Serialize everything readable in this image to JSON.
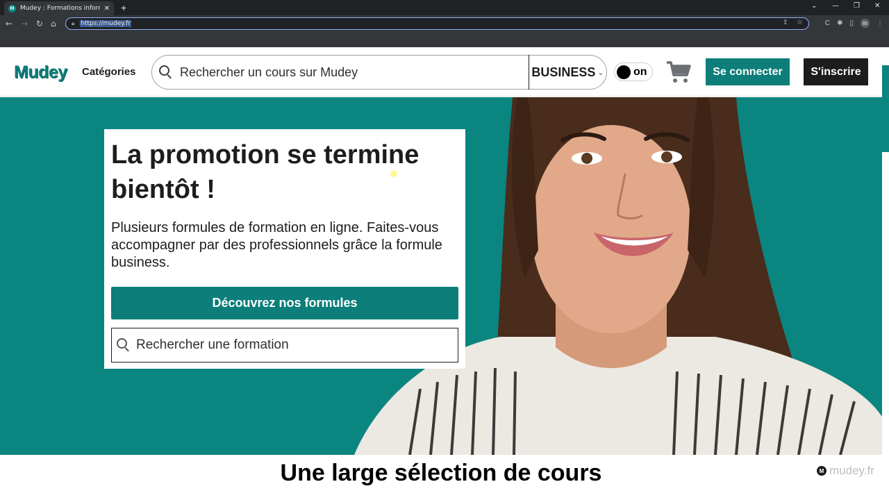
{
  "browser": {
    "tab_title": "Mudey : Formations informatiqu",
    "tab_favicon_letter": "M",
    "url": "https://mudey.fr",
    "profile_initial": "m"
  },
  "header": {
    "logo": "Mudey",
    "categories": "Catégories",
    "search_placeholder": "Rechercher un cours sur Mudey",
    "business_select": "BUSINESS",
    "toggle_label": "on",
    "login_button": "Se connecter",
    "signup_button": "S'inscrire"
  },
  "hero": {
    "title": "La promotion se termine bientôt !",
    "text": "Plusieurs formules de formation en ligne. Faites-vous accompagner par des professionnels grâce la formule business.",
    "cta_button": "Découvrez nos formules",
    "search_placeholder": "Rechercher une formation"
  },
  "caption": "Une large sélection de cours",
  "watermark": {
    "logo_letter": "M",
    "text": "mudey.fr"
  },
  "colors": {
    "brand_teal": "#0d7e7a",
    "hero_bg": "#0b8580",
    "dark": "#1c1d1f"
  }
}
